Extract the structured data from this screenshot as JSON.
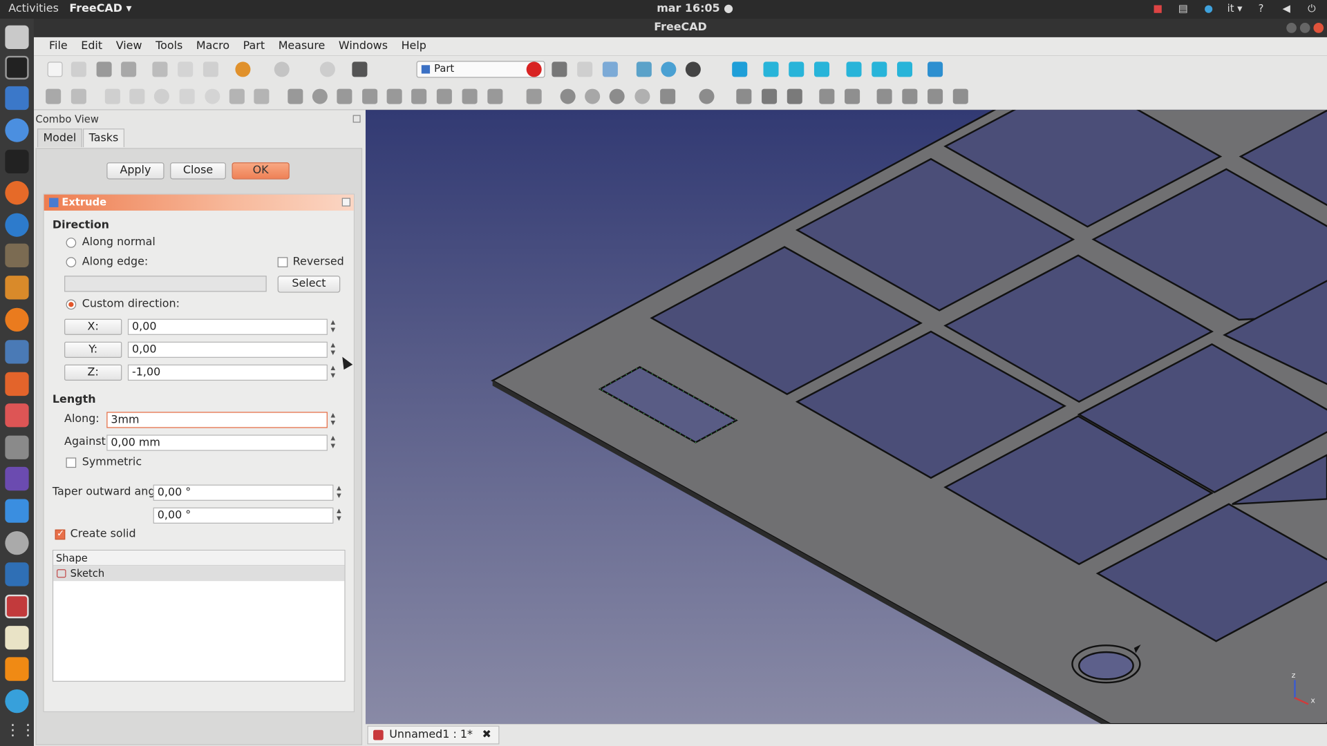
{
  "system": {
    "activities": "Activities",
    "app_menu": "FreeCAD ▾",
    "clock": "mar 16:05 ●",
    "lang": "it ▾",
    "help_icon_text": "?"
  },
  "window": {
    "title": "FreeCAD"
  },
  "menubar": [
    "File",
    "Edit",
    "View",
    "Tools",
    "Macro",
    "Part",
    "Measure",
    "Windows",
    "Help"
  ],
  "toolbar": {
    "workbench": "Part"
  },
  "combo": {
    "title": "Combo View",
    "tabs": [
      "Model",
      "Tasks"
    ],
    "active_tab": "Tasks",
    "buttons": {
      "apply": "Apply",
      "close": "Close",
      "ok": "OK"
    }
  },
  "extrude": {
    "title": "Extrude",
    "direction_label": "Direction",
    "along_normal": "Along normal",
    "along_edge": "Along edge:",
    "reversed": "Reversed",
    "select": "Select",
    "custom_direction": "Custom direction:",
    "x_label": "X:",
    "x_value": "0,00",
    "y_label": "Y:",
    "y_value": "0,00",
    "z_label": "Z:",
    "z_value": "-1,00",
    "length_label": "Length",
    "along_label": "Along:",
    "along_value": "3mm",
    "against_label": "Against:",
    "against_value": "0,00 mm",
    "symmetric": "Symmetric",
    "taper_label": "Taper outward angle",
    "taper_value_1": "0,00 °",
    "taper_value_2": "0,00 °",
    "create_solid": "Create solid",
    "shape_header": "Shape",
    "shape_item": "Sketch"
  },
  "document_tab": {
    "label": "Unnamed1 : 1*"
  },
  "axis": {
    "x": "x",
    "z": "z"
  },
  "colors": {
    "accent": "#ef8157",
    "viewport_top": "#323a73",
    "viewport_bottom": "#898aa6",
    "plate": "#6e6e70"
  }
}
